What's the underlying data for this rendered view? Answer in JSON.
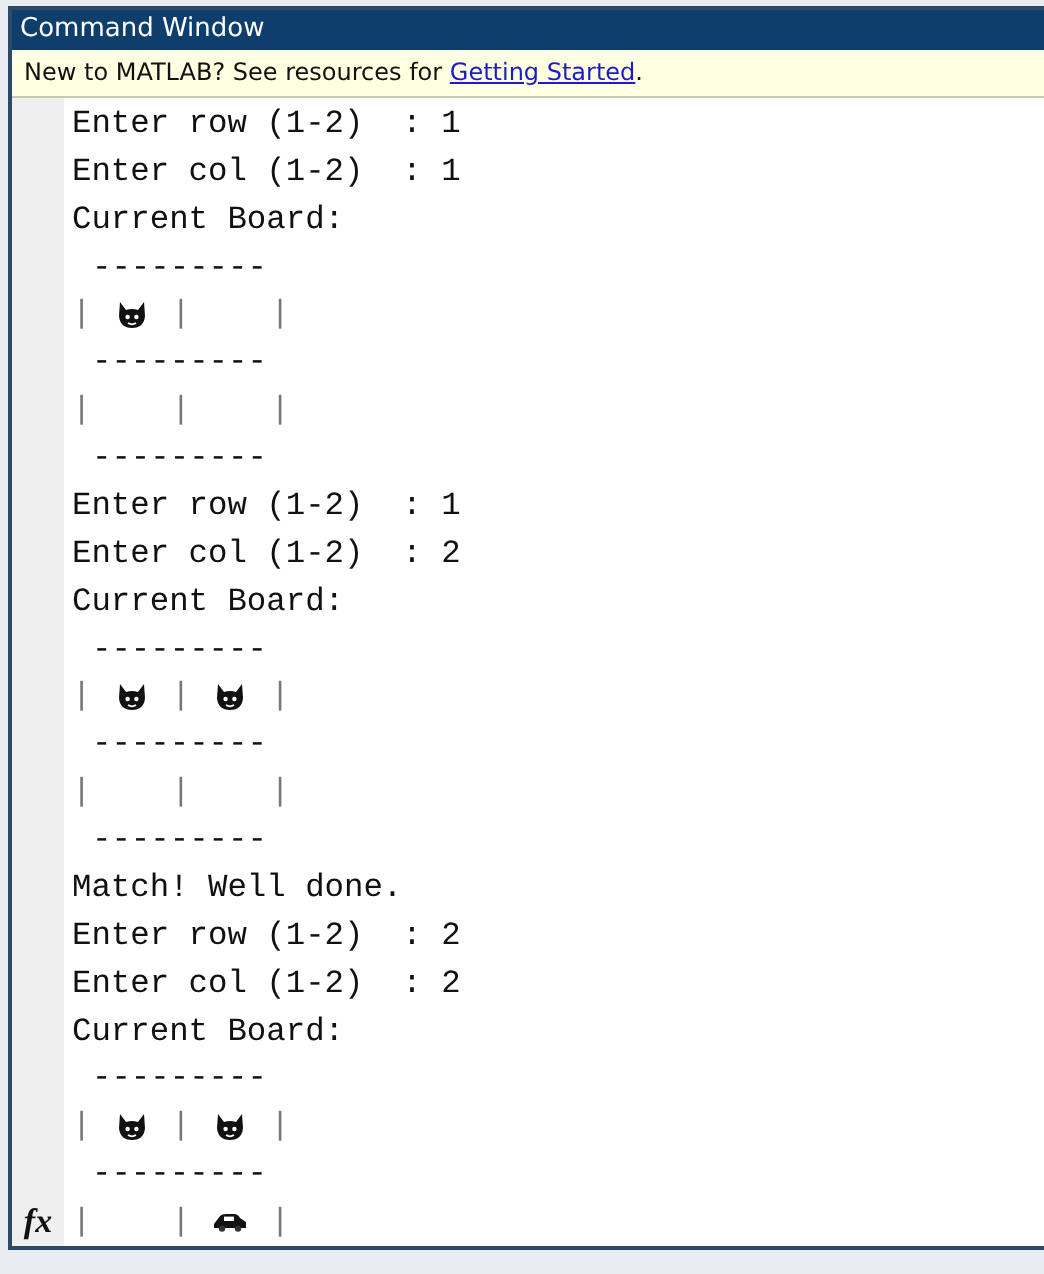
{
  "window": {
    "title": "Command Window"
  },
  "banner": {
    "text": "New to MATLAB? See resources for ",
    "link": "Getting Started",
    "after": "."
  },
  "prompt": {
    "symbol": "fx"
  },
  "lines": [
    {
      "kind": "text",
      "text": "Enter row (1-2)  : 1"
    },
    {
      "kind": "text",
      "text": "Enter col (1-2)  : 1"
    },
    {
      "kind": "text",
      "text": "Current Board:"
    },
    {
      "kind": "rule",
      "text": "---------"
    },
    {
      "kind": "row",
      "divider": "|",
      "cells": [
        {
          "kind": "cat"
        },
        {
          "kind": "empty"
        }
      ]
    },
    {
      "kind": "rule",
      "text": "---------"
    },
    {
      "kind": "row",
      "divider": "|",
      "cells": [
        {
          "kind": "empty"
        },
        {
          "kind": "empty"
        }
      ]
    },
    {
      "kind": "rule",
      "text": "---------"
    },
    {
      "kind": "text",
      "text": "Enter row (1-2)  : 1"
    },
    {
      "kind": "text",
      "text": "Enter col (1-2)  : 2"
    },
    {
      "kind": "text",
      "text": "Current Board:"
    },
    {
      "kind": "rule",
      "text": "---------"
    },
    {
      "kind": "row",
      "divider": "|",
      "cells": [
        {
          "kind": "cat"
        },
        {
          "kind": "cat"
        }
      ]
    },
    {
      "kind": "rule",
      "text": "---------"
    },
    {
      "kind": "row",
      "divider": "|",
      "cells": [
        {
          "kind": "empty"
        },
        {
          "kind": "empty"
        }
      ]
    },
    {
      "kind": "rule",
      "text": "---------"
    },
    {
      "kind": "text",
      "text": "Match! Well done."
    },
    {
      "kind": "text",
      "text": "Enter row (1-2)  : 2"
    },
    {
      "kind": "text",
      "text": "Enter col (1-2)  : 2"
    },
    {
      "kind": "text",
      "text": "Current Board:"
    },
    {
      "kind": "rule",
      "text": "---------"
    },
    {
      "kind": "row",
      "divider": "|",
      "cells": [
        {
          "kind": "cat"
        },
        {
          "kind": "cat"
        }
      ]
    },
    {
      "kind": "rule",
      "text": "---------"
    },
    {
      "kind": "row",
      "divider": "|",
      "cells": [
        {
          "kind": "empty"
        },
        {
          "kind": "car"
        }
      ]
    }
  ]
}
